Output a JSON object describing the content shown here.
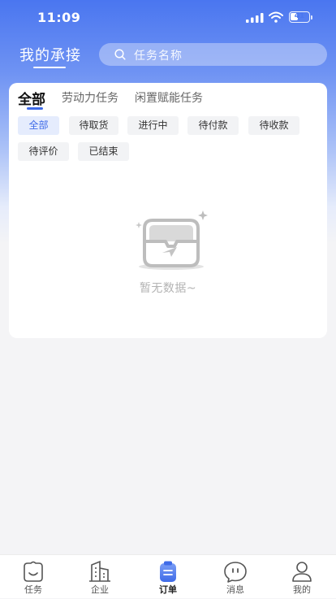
{
  "status_bar": {
    "time": "11:09",
    "battery": "41",
    "battery_level": 0.41
  },
  "header": {
    "title": "我的承接",
    "search_placeholder": "任务名称"
  },
  "tabs": [
    {
      "label": "全部",
      "active": true
    },
    {
      "label": "劳动力任务",
      "active": false
    },
    {
      "label": "闲置赋能任务",
      "active": false
    }
  ],
  "filters": [
    {
      "label": "全部",
      "active": true
    },
    {
      "label": "待取货",
      "active": false
    },
    {
      "label": "进行中",
      "active": false
    },
    {
      "label": "待付款",
      "active": false
    },
    {
      "label": "待收款",
      "active": false
    },
    {
      "label": "待评价",
      "active": false
    },
    {
      "label": "已结束",
      "active": false
    }
  ],
  "empty_state": {
    "text": "暂无数据~",
    "icon": "empty-box-icon"
  },
  "bottom_nav": [
    {
      "label": "任务",
      "icon": "task-icon",
      "active": false
    },
    {
      "label": "企业",
      "icon": "building-icon",
      "active": false
    },
    {
      "label": "订单",
      "icon": "order-icon",
      "active": true
    },
    {
      "label": "消息",
      "icon": "message-icon",
      "active": false
    },
    {
      "label": "我的",
      "icon": "profile-icon",
      "active": false
    }
  ],
  "colors": {
    "accent": "#3f6be8",
    "header_gradient_top": "#4a76f0",
    "background": "#f4f4f6"
  }
}
